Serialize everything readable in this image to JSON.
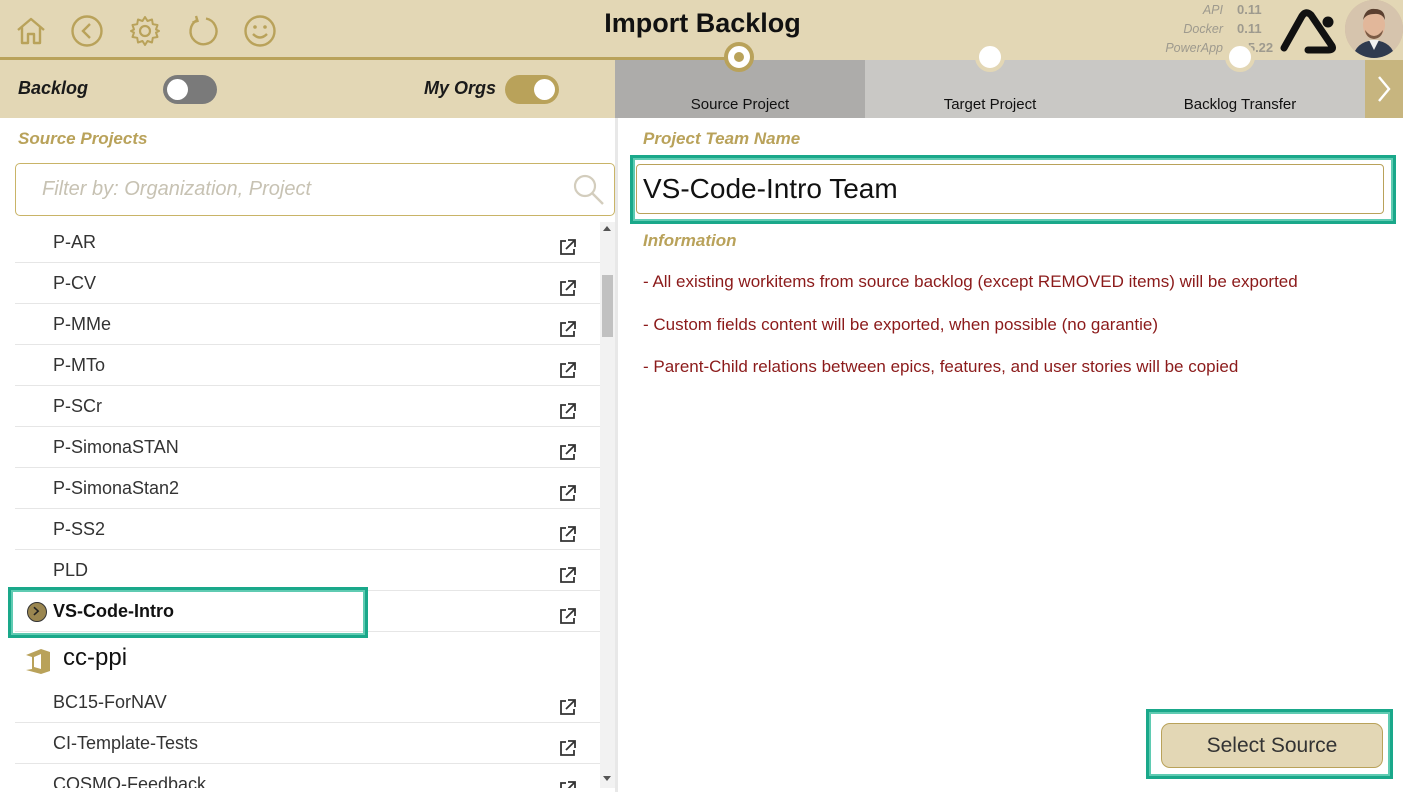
{
  "header": {
    "title": "Import Backlog",
    "icons": [
      "home-icon",
      "back-icon",
      "gear-icon",
      "refresh-icon",
      "smiley-icon"
    ],
    "versions": [
      {
        "label": "API",
        "value": "0.11"
      },
      {
        "label": "Docker",
        "value": "0.11"
      },
      {
        "label": "PowerApp",
        "value": "2.5.22"
      }
    ]
  },
  "toolbar": {
    "backlog_label": "Backlog",
    "backlog_on": false,
    "myorgs_label": "My Orgs",
    "myorgs_on": true
  },
  "steps": [
    {
      "label": "Source Project",
      "active": true
    },
    {
      "label": "Target Project",
      "active": false
    },
    {
      "label": "Backlog Transfer",
      "active": false
    }
  ],
  "left": {
    "section_label": "Source Projects",
    "filter_placeholder": "Filter by: Organization, Project",
    "projects_a": [
      "P-AR",
      "P-CV",
      "P-MMe",
      "P-MTo",
      "P-SCr",
      "P-SimonaSTAN",
      "P-SimonaStan2",
      "P-SS2",
      "PLD"
    ],
    "selected_project": "VS-Code-Intro",
    "org_name": "cc-ppi",
    "projects_b": [
      "BC15-ForNAV",
      "CI-Template-Tests",
      "COSMO-Feedback"
    ]
  },
  "right": {
    "team_label": "Project Team Name",
    "team_value": "VS-Code-Intro Team",
    "info_label": "Information",
    "info_lines": [
      "- All existing workitems from source backlog (except REMOVED items) will be exported",
      "- Custom fields content will be exported, when possible (no garantie)",
      "- Parent-Child relations between epics, features, and user stories will be copied"
    ],
    "select_button": "Select Source"
  },
  "colors": {
    "accent": "#b9a25a",
    "header_bg": "#e3d7b5",
    "info_text": "#8b1a1a",
    "highlight": "#1aa88a"
  }
}
